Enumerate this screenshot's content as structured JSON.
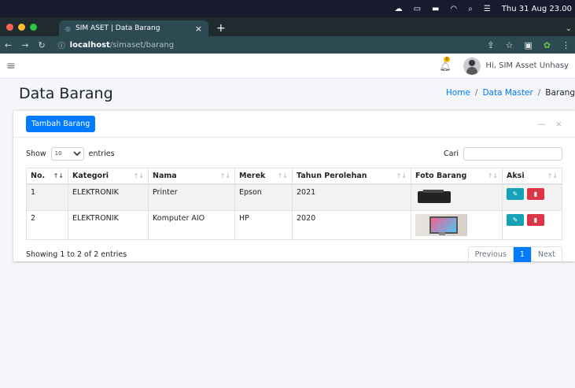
{
  "os_menubar": {
    "clock": "Thu 31 Aug  23.00"
  },
  "browser": {
    "tab_title": "SIM ASET | Data Barang",
    "tab_close": "×",
    "new_tab": "+",
    "url_host": "localhost",
    "url_path": "/simaset/barang"
  },
  "header": {
    "notification_count": "0",
    "greeting": "Hi, SIM Asset Unhasy"
  },
  "page": {
    "title": "Data Barang",
    "breadcrumb": [
      "Home",
      "Data Master",
      "Barang"
    ],
    "breadcrumb_sep": "/"
  },
  "card": {
    "add_button": "Tambah Barang",
    "minimize": "—",
    "close": "×"
  },
  "datatable": {
    "show_label": "Show",
    "entries_value": "10",
    "entries_label": "entries",
    "search_label": "Cari",
    "columns": [
      "No.",
      "Kategori",
      "Nama",
      "Merek",
      "Tahun Perolehan",
      "Foto Barang",
      "Aksi"
    ],
    "rows": [
      {
        "no": "1",
        "kategori": "ELEKTRONIK",
        "nama": "Printer",
        "merek": "Epson",
        "tahun": "2021"
      },
      {
        "no": "2",
        "kategori": "ELEKTRONIK",
        "nama": "Komputer AIO",
        "merek": "HP",
        "tahun": "2020"
      }
    ],
    "info": "Showing 1 to 2 of 2 entries",
    "pager": {
      "previous": "Previous",
      "current": "1",
      "next": "Next"
    }
  }
}
